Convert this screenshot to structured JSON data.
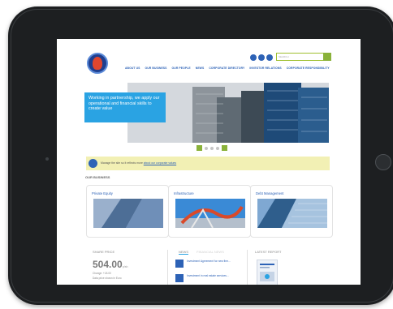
{
  "site": {
    "search_placeholder": "SEARCH",
    "nav": [
      "ABOUT US",
      "OUR BUSINESS",
      "OUR PEOPLE",
      "NEWS",
      "CORPORATE DIRECTORY",
      "INVESTOR RELATIONS",
      "CORPORATE RESPONSIBILITY"
    ]
  },
  "hero": {
    "callout": "Working in partnership, we apply our operational and financial skills to create value",
    "slides": 4
  },
  "notice": {
    "text": "Manage the site so it reflects more ",
    "link": "about our corporate values"
  },
  "business": {
    "heading": "OUR BUSINESS",
    "cards": [
      {
        "label": "Private Equity"
      },
      {
        "label": "Infrastructure"
      },
      {
        "label": "Debt Management"
      }
    ]
  },
  "share_price": {
    "title": "SHARE PRICE",
    "value": "504.00",
    "unit": "p/sh",
    "change": "Change: +18.00",
    "detail": "Data price shown in Euro"
  },
  "news": {
    "tabs": [
      "NEWS",
      "FINANCIAL NEWS"
    ],
    "items": [
      {
        "text": "Investment Agreement for new firm..."
      },
      {
        "text": "Investment in real estate services..."
      }
    ]
  },
  "report": {
    "title": "LATEST REPORT"
  },
  "colors": {
    "brand_blue": "#2d62b6",
    "accent_cyan": "#2aa3e3",
    "accent_green": "#8ab23a",
    "notice_bg": "#f2f0b4",
    "tablet_body": "#1d1f21"
  }
}
